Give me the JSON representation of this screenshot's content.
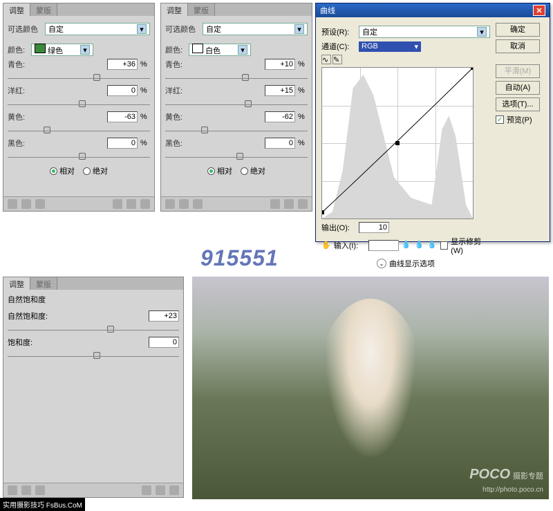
{
  "panels": {
    "p1": {
      "tabs": [
        "调整",
        "蒙版"
      ],
      "title_label": "可选颜色",
      "preset_value": "自定",
      "color_label": "颜色:",
      "color_value": "绿色",
      "swatch_hex": "#3a8a3a",
      "sliders": [
        {
          "label": "青色:",
          "value": "+36",
          "unit": "%",
          "pos": 60
        },
        {
          "label": "洋红:",
          "value": "0",
          "unit": "%",
          "pos": 50
        },
        {
          "label": "黄色:",
          "value": "-63",
          "unit": "%",
          "pos": 25
        },
        {
          "label": "黑色:",
          "value": "0",
          "unit": "%",
          "pos": 50
        }
      ],
      "radio1": "相对",
      "radio2": "绝对"
    },
    "p2": {
      "tabs": [
        "调整",
        "蒙版"
      ],
      "title_label": "可选颜色",
      "preset_value": "自定",
      "color_label": "颜色:",
      "color_value": "白色",
      "swatch_hex": "#ffffff",
      "sliders": [
        {
          "label": "青色:",
          "value": "+10",
          "unit": "%",
          "pos": 54
        },
        {
          "label": "洋红:",
          "value": "+15",
          "unit": "%",
          "pos": 56
        },
        {
          "label": "黄色:",
          "value": "-62",
          "unit": "%",
          "pos": 25
        },
        {
          "label": "黑色:",
          "value": "0",
          "unit": "%",
          "pos": 50
        }
      ],
      "radio1": "相对",
      "radio2": "绝对"
    },
    "p3": {
      "tabs": [
        "调整",
        "蒙版"
      ],
      "title_label": "自然饱和度",
      "sliders": [
        {
          "label": "自然饱和度:",
          "value": "+23",
          "pos": 58
        },
        {
          "label": "饱和度:",
          "value": "0",
          "pos": 50
        }
      ]
    }
  },
  "curves": {
    "title": "曲线",
    "preset_label": "预设(R):",
    "preset_value": "自定",
    "channel_label": "通道(C):",
    "channel_value": "RGB",
    "output_label": "输出(O):",
    "output_value": "10",
    "input_label": "输入(I):",
    "input_value": "",
    "show_clip_label": "显示修剪(W)",
    "expand_label": "曲线显示选项",
    "buttons": {
      "ok": "确定",
      "cancel": "取消",
      "smooth": "平滑(M)",
      "auto": "自动(A)",
      "options": "选项(T)..."
    },
    "preview_label": "预览(P)"
  },
  "watermark_center": "915551",
  "photo_wm": {
    "brand": "POCO",
    "subtitle": "摄影专题",
    "url": "http://photo.poco.cn"
  },
  "corner_wm": "实用摄影技巧 FsBus.CoM",
  "chart_data": {
    "type": "line",
    "title": "曲线 (Curves)",
    "xlabel": "输入",
    "ylabel": "输出",
    "xlim": [
      0,
      255
    ],
    "ylim": [
      0,
      255
    ],
    "points": [
      [
        0,
        10
      ],
      [
        128,
        130
      ],
      [
        255,
        255
      ]
    ],
    "histogram_peaks": [
      {
        "x": 60,
        "height": 0.95
      },
      {
        "x": 100,
        "height": 0.55
      },
      {
        "x": 200,
        "height": 0.6
      }
    ]
  }
}
